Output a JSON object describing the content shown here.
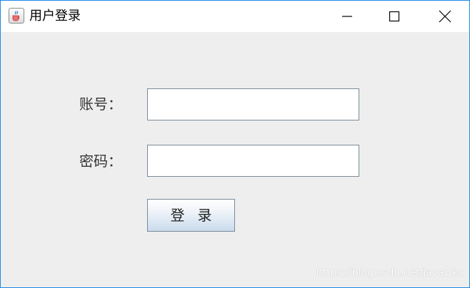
{
  "window": {
    "title": "用户登录",
    "icon": "java-cup-icon",
    "controls": [
      "minimize-icon",
      "maximize-icon",
      "close-icon"
    ]
  },
  "form": {
    "account_label": "账号：",
    "account_value": "",
    "password_label": "密码：",
    "password_value": "",
    "login_label": "登录"
  },
  "watermark": "https://blog.csdn.net/javawkc",
  "colors": {
    "window_border": "#1e88e5",
    "background": "#eeeeee",
    "titlebar": "#ffffff",
    "button_gradient_bottom": "#c9dbec"
  }
}
